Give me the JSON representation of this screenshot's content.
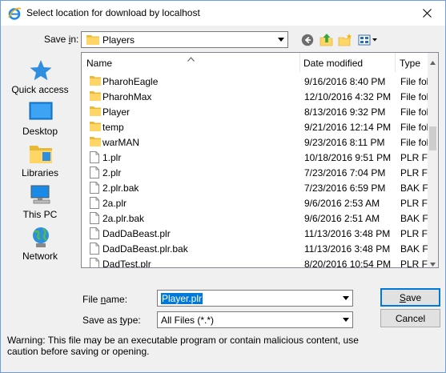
{
  "window": {
    "title": "Select location for download by localhost"
  },
  "toolbar": {
    "save_in_label": "Save in:",
    "save_in_value": "Players"
  },
  "places": [
    {
      "label": "Quick access",
      "icon": "star-icon"
    },
    {
      "label": "Desktop",
      "icon": "desktop-icon"
    },
    {
      "label": "Libraries",
      "icon": "libraries-icon"
    },
    {
      "label": "This PC",
      "icon": "computer-icon"
    },
    {
      "label": "Network",
      "icon": "network-icon"
    }
  ],
  "columns": {
    "name": "Name",
    "date": "Date modified",
    "type": "Type"
  },
  "files": [
    {
      "name": "PharohEagle",
      "date": "9/16/2016 8:40 PM",
      "type": "File fol",
      "kind": "folder"
    },
    {
      "name": "PharohMax",
      "date": "12/10/2016 4:32 PM",
      "type": "File fol",
      "kind": "folder"
    },
    {
      "name": "Player",
      "date": "8/13/2016 9:32 PM",
      "type": "File fol",
      "kind": "folder"
    },
    {
      "name": "temp",
      "date": "9/21/2016 12:14 PM",
      "type": "File fol",
      "kind": "folder"
    },
    {
      "name": "warMAN",
      "date": "9/23/2016 8:11 PM",
      "type": "File fol",
      "kind": "folder"
    },
    {
      "name": "1.plr",
      "date": "10/18/2016 9:51 PM",
      "type": "PLR Fil",
      "kind": "file"
    },
    {
      "name": "2.plr",
      "date": "7/23/2016 7:04 PM",
      "type": "PLR Fil",
      "kind": "file"
    },
    {
      "name": "2.plr.bak",
      "date": "7/23/2016 6:59 PM",
      "type": "BAK Fil",
      "kind": "file"
    },
    {
      "name": "2a.plr",
      "date": "9/6/2016 2:53 AM",
      "type": "PLR Fil",
      "kind": "file"
    },
    {
      "name": "2a.plr.bak",
      "date": "9/6/2016 2:51 AM",
      "type": "BAK Fil",
      "kind": "file"
    },
    {
      "name": "DadDaBeast.plr",
      "date": "11/13/2016 3:48 PM",
      "type": "PLR Fil",
      "kind": "file"
    },
    {
      "name": "DadDaBeast.plr.bak",
      "date": "11/13/2016 3:48 PM",
      "type": "BAK Fil",
      "kind": "file"
    },
    {
      "name": "DadTest.plr",
      "date": "8/20/2016 10:54 PM",
      "type": "PLR Fil",
      "kind": "file"
    }
  ],
  "form": {
    "file_name_label": "File name:",
    "file_name_value": "Player.plr",
    "save_as_type_label": "Save as type:",
    "save_as_type_value": "All Files (*.*)"
  },
  "buttons": {
    "save": "Save",
    "cancel": "Cancel"
  },
  "warning": "Warning: This file may be an executable program or contain malicious content, use caution before saving or opening.",
  "colors": {
    "selection": "#0078d7",
    "folder": "#ffd665",
    "dialog_bg": "#f0f0f0"
  }
}
